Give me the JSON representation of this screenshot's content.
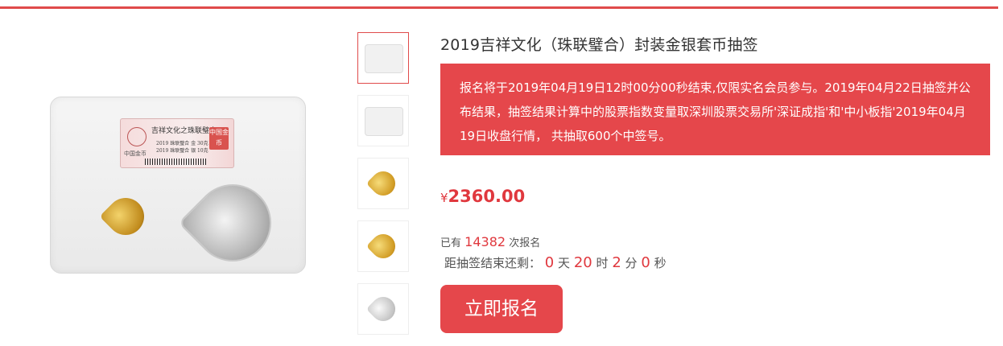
{
  "product": {
    "title": "2019吉祥文化（珠联璧合）封装金银套币抽签",
    "notice": "报名将于2019年04月19日12时00分00秒结束,仅限实名会员参与。2019年04月22日抽签并公布结果，抽签结果计算中的股票指数变量取深圳股票交易所'深证成指'和'中小板指'2019年04月19日收盘行情， 共抽取600个中签号。",
    "price_symbol": "¥",
    "price": "2360.00",
    "signup_prefix": "已有",
    "signup_count": "14382",
    "signup_suffix": "次报名",
    "countdown_label": "距抽签结束还剩：",
    "countdown": {
      "days": "0",
      "days_unit": "天",
      "hours": "20",
      "hours_unit": "时",
      "minutes": "2",
      "minutes_unit": "分",
      "seconds": "0",
      "seconds_unit": "秒"
    },
    "button_label": "立即报名"
  },
  "image_label": {
    "title": "吉祥文化之珠联璧合",
    "mint": "中国金币",
    "line1": "2019  珠联璧合 金  30克",
    "line2": "2019  珠联璧合 银  10克",
    "stamp": "中国金币"
  },
  "colors": {
    "accent": "#e5474b",
    "price": "#e0383e"
  }
}
